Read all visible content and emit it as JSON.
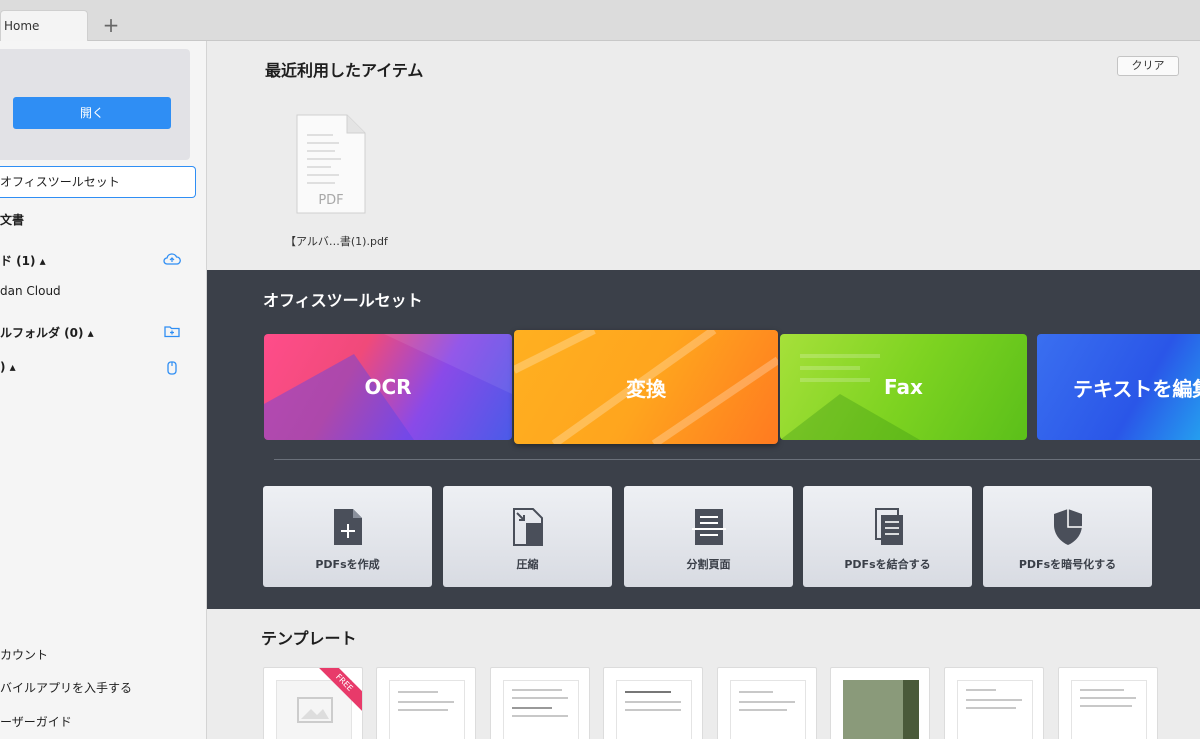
{
  "tabs": {
    "home_label": "Home",
    "add_symbol": "+"
  },
  "sidebar": {
    "open_button": "開く",
    "items": [
      {
        "label": "オフィスツールセット"
      },
      {
        "label": "文書"
      },
      {
        "label": "ド (1) ▴"
      },
      {
        "label": "dan Cloud"
      },
      {
        "label": "ルフォルダ (0) ▴"
      },
      {
        "label": ") ▴"
      }
    ],
    "bottom": [
      {
        "label": "カウント"
      },
      {
        "label": "バイルアプリを入手する"
      },
      {
        "label": "ーザーガイド"
      }
    ]
  },
  "recent": {
    "title": "最近利用したアイテム",
    "clear_button": "クリア",
    "file_label": "【アルバ…書(1).pdf",
    "file_type": "PDF"
  },
  "tools": {
    "title": "オフィスツールセット",
    "cards": [
      {
        "label": "OCR"
      },
      {
        "label": "変換"
      },
      {
        "label": "Fax"
      },
      {
        "label": "テキストを編集"
      }
    ],
    "buttons": [
      {
        "label": "PDFsを作成",
        "icon": "file-plus-icon"
      },
      {
        "label": "圧縮",
        "icon": "compress-icon"
      },
      {
        "label": "分割頁面",
        "icon": "split-page-icon"
      },
      {
        "label": "PDFsを結合する",
        "icon": "merge-icon"
      },
      {
        "label": "PDFsを暗号化する",
        "icon": "shield-icon"
      }
    ]
  },
  "templates": {
    "title": "テンプレート",
    "free_badge": "FREE"
  },
  "colors": {
    "accent": "#2f8ef4",
    "tools_bg": "#3b4049"
  }
}
